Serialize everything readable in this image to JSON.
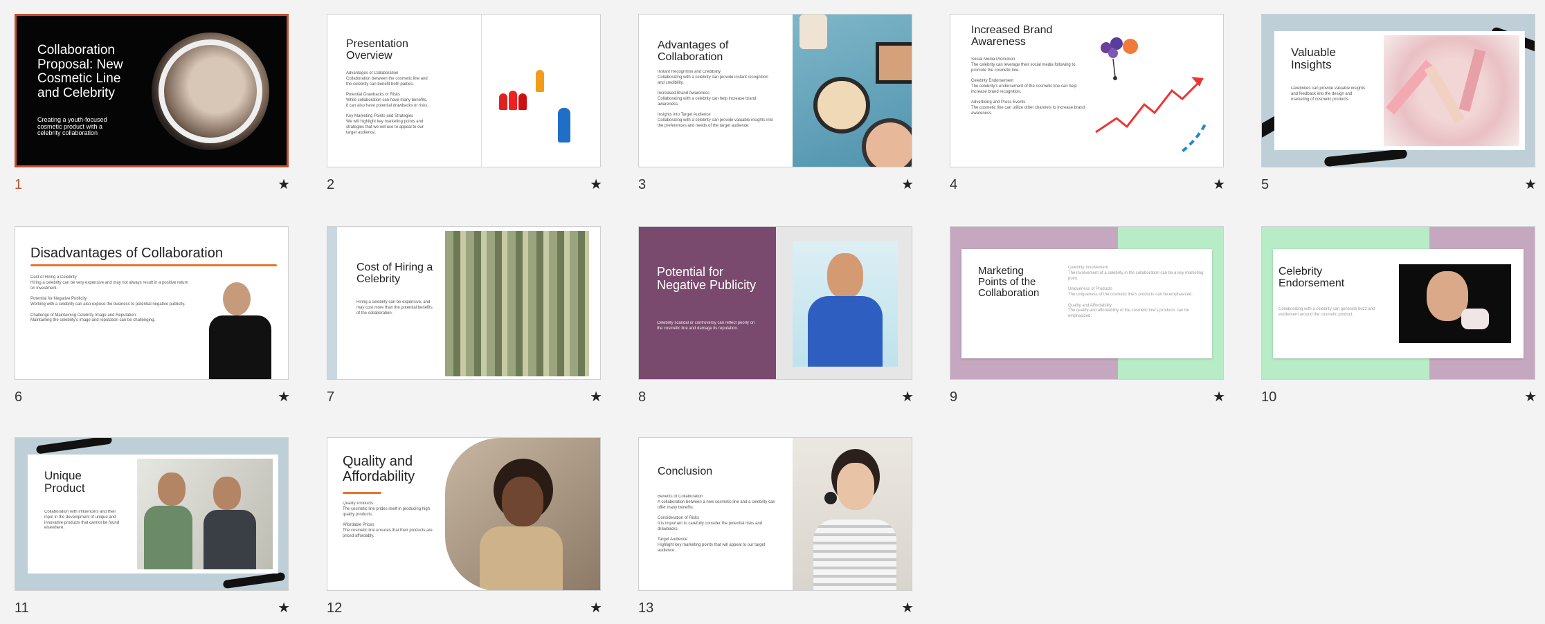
{
  "slides": [
    {
      "number": "1",
      "title": "Collaboration Proposal: New Cosmetic Line and Celebrity",
      "subtitle": "Creating a youth-focused cosmetic product with a celebrity collaboration"
    },
    {
      "number": "2",
      "title": "Presentation Overview",
      "body": "Advantages of Collaboration\nCollaboration between the cosmetic line and the celebrity can benefit both parties.\n\nPotential Drawbacks or Risks\nWhile collaboration can have many benefits, it can also have potential drawbacks or risks.\n\nKey Marketing Points and Strategies\nWe will highlight key marketing points and strategies that we will use to appeal to our target audience."
    },
    {
      "number": "3",
      "title": "Advantages of Collaboration",
      "body": "Instant Recognition and Credibility\nCollaborating with a celebrity can provide instant recognition and credibility.\n\nIncreased Brand Awareness\nCollaborating with a celebrity can help increase brand awareness.\n\nInsights into Target Audience\nCollaborating with a celebrity can provide valuable insights into the preferences and needs of the target audience."
    },
    {
      "number": "4",
      "title": "Increased Brand Awareness",
      "body": "Social Media Promotion\nThe celebrity can leverage their social media following to promote the cosmetic line.\n\nCelebrity Endorsement\nThe celebrity's endorsement of the cosmetic line can help increase brand recognition.\n\nAdvertising and Press Events\nThe cosmetic line can utilize other channels to increase brand awareness."
    },
    {
      "number": "5",
      "title": "Valuable Insights",
      "body": "Celebrities can provide valuable insights and feedback into the design and marketing of cosmetic products."
    },
    {
      "number": "6",
      "title": "Disadvantages of Collaboration",
      "body": "Cost of Hiring a Celebrity\nHiring a celebrity can be very expensive and may not always result in a positive return on investment.\n\nPotential for Negative Publicity\nWorking with a celebrity can also expose the business to potential negative publicity.\n\nChallenge of Maintaining Celebrity Image and Reputation\nMaintaining the celebrity's image and reputation can be challenging."
    },
    {
      "number": "7",
      "title": "Cost of Hiring a Celebrity",
      "body": "Hiring a celebrity can be expensive, and may cost more than the potential benefits of the collaboration."
    },
    {
      "number": "8",
      "title": "Potential for Negative Publicity",
      "body": "Celebrity scandal or controversy can reflect poorly on the cosmetic line and damage its reputation."
    },
    {
      "number": "9",
      "title": "Marketing Points of the Collaboration",
      "body": "Celebrity Involvement\nThe involvement of a celebrity in the collaboration can be a key marketing point.\n\nUniqueness of Products\nThe uniqueness of the cosmetic line's products can be emphasized.\n\nQuality and Affordability\nThe quality and affordability of the cosmetic line's products can be emphasized."
    },
    {
      "number": "10",
      "title": "Celebrity Endorsement",
      "body": "Collaborating with a celebrity can generate buzz and excitement around the cosmetic product."
    },
    {
      "number": "11",
      "title": "Unique Product",
      "body": "Collaboration with influencers and their input in the development of unique and innovative products that cannot be found elsewhere."
    },
    {
      "number": "12",
      "title": "Quality and Affordability",
      "body": "Quality Products\nThe cosmetic line prides itself in producing high quality products.\n\nAffordable Prices\nThe cosmetic line ensures that their products are priced affordably."
    },
    {
      "number": "13",
      "title": "Conclusion",
      "body": "Benefits of Collaboration\nA collaboration between a new cosmetic line and a celebrity can offer many benefits.\n\nConsideration of Risks\nIt is important to carefully consider the potential risks and drawbacks.\n\nTarget Audience\nHighlight key marketing points that will appeal to our target audience."
    }
  ],
  "icons": {
    "slide_action": "★"
  },
  "colors": {
    "accent": "#c0522e",
    "orange_rule": "#e8742a",
    "purple": "#7a4a6e",
    "mint": "#b8ecc6",
    "lilac": "#c5a7bf"
  }
}
